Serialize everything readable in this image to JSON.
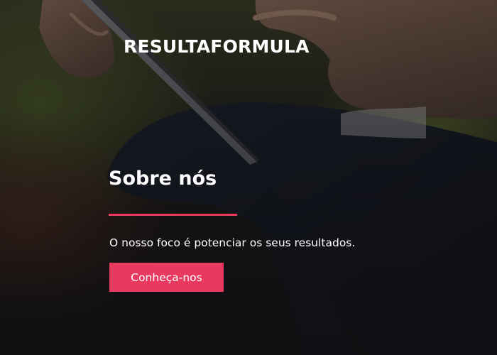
{
  "header": {
    "brand": "RESULTAFORMULA"
  },
  "about": {
    "title": "Sobre nós",
    "tagline": "O nosso foco é potenciar os seus resultados.",
    "cta_label": "Conheça-nos"
  },
  "colors": {
    "accent": "#e8395f",
    "text": "#ffffff",
    "overlay": "#0d0e12"
  },
  "hero_image": {
    "subject": "hands-holding-tablet-photo"
  }
}
